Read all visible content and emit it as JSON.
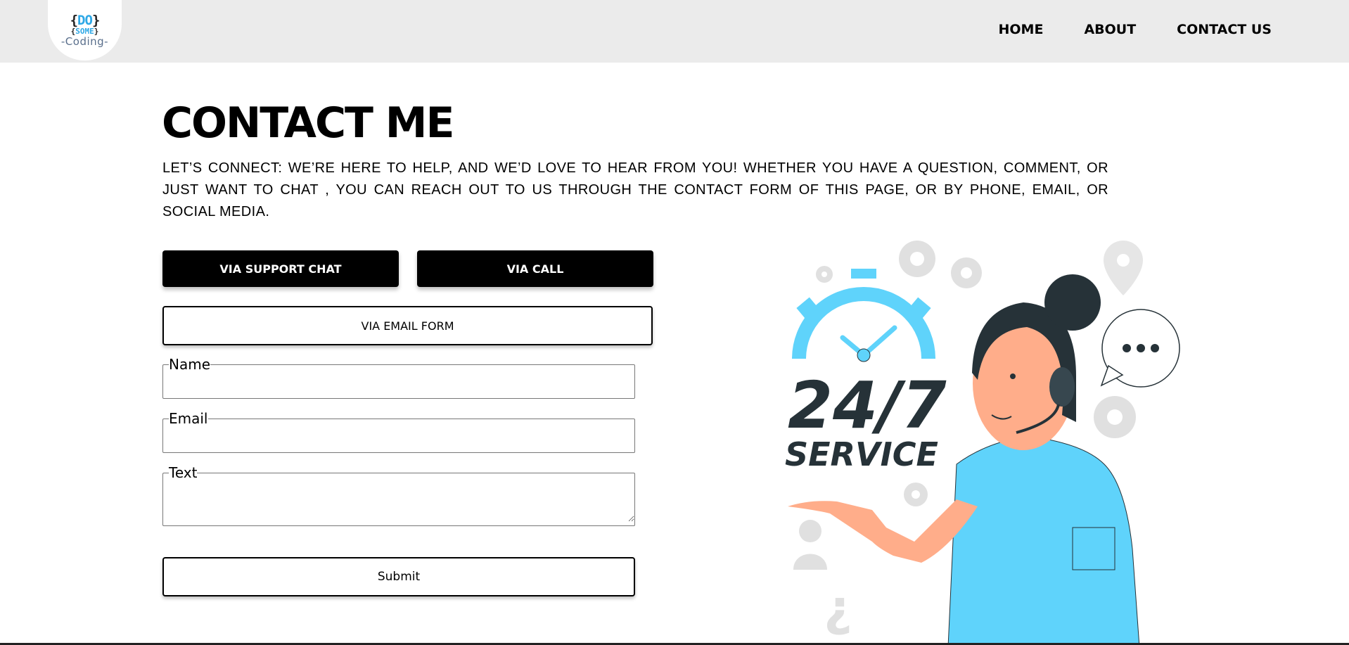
{
  "header": {
    "logo": {
      "line1_open": "{",
      "line1_text": "DO",
      "line1_close": "}",
      "line2_open": "{",
      "line2_text": "SOME",
      "line2_close": "}",
      "line3": "-Coding-"
    },
    "nav": [
      {
        "label": "HOME"
      },
      {
        "label": "ABOUT"
      },
      {
        "label": "CONTACT US"
      }
    ]
  },
  "main": {
    "title": "CONTACT ME",
    "intro": "LET’S CONNECT: WE’RE HERE TO HELP, AND WE’D LOVE TO HEAR FROM YOU! WHETHER YOU HAVE A QUESTION, COMMENT, OR JUST WANT TO CHAT , YOU CAN REACH OUT TO US THROUGH THE CONTACT FORM OF THIS PAGE, OR BY PHONE, EMAIL, OR SOCIAL MEDIA.",
    "buttons": {
      "support_chat": "VIA SUPPORT CHAT",
      "call": "VIA CALL",
      "email_form": "VIA EMAIL FORM"
    },
    "form": {
      "name_label": "Name",
      "name_value": "",
      "email_label": "Email",
      "email_value": "",
      "text_label": "Text",
      "text_value": "",
      "submit": "Submit"
    },
    "illustration": {
      "big_text": "24/7",
      "service_text": "SERVICE",
      "accent_color": "#5fd3fb",
      "dark_color": "#263238"
    }
  }
}
